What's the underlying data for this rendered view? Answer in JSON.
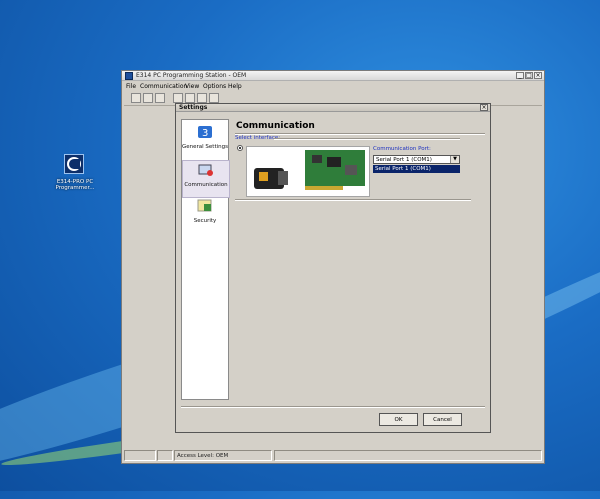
{
  "desktop": {
    "icon_label_line1": "E314-PRO PC",
    "icon_label_line2": "Programmer..."
  },
  "app": {
    "title": "E314 PC Programming Station - OEM",
    "menu": [
      "File",
      "Communication",
      "View",
      "Options",
      "Help"
    ],
    "status": {
      "access_level": "Access Level: OEM"
    }
  },
  "dialog": {
    "title": "Settings",
    "nav": [
      {
        "label": "General Settings",
        "icon": "general-settings-icon"
      },
      {
        "label": "Communication",
        "icon": "communication-icon",
        "selected": true
      },
      {
        "label": "Security",
        "icon": "security-icon"
      }
    ],
    "heading": "Communication",
    "select_interface_label": "Select interface:",
    "port": {
      "label": "Communication Port:",
      "selected": "Serial Port 1 (COM1)",
      "options": [
        "Serial Port 1 (COM1)"
      ]
    },
    "buttons": {
      "ok": "OK",
      "cancel": "Cancel"
    }
  }
}
